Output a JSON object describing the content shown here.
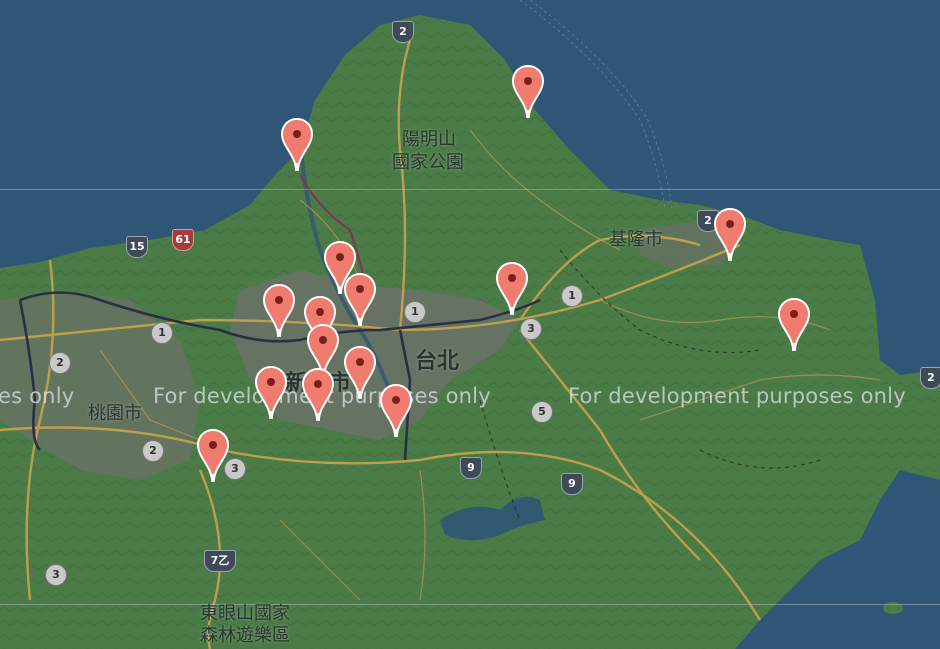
{
  "map": {
    "watermark_text": "For development purposes only",
    "watermark_left_partial": "es only",
    "watermark_mid_partial": "For develo",
    "watermark_mid_partial2": "pment purposes only",
    "colors": {
      "sea": "#2f5676",
      "land": "#4a7a45",
      "land_dark": "#3f6b3c",
      "urban": "#6a7168",
      "road_major": "#c8a24a",
      "road_minor": "#b39a55",
      "rail": "#2b2f45",
      "marker": "#f07b6f"
    }
  },
  "places": {
    "yangmingshan_line1": "陽明山",
    "yangmingshan_line2": "國家公園",
    "keelung": "基隆市",
    "taipei": "台北",
    "new_taipei": "新北市",
    "taoyuan": "桃園市",
    "dongyanshan_line1": "東眼山國家",
    "dongyanshan_line2": "森林遊樂區"
  },
  "shields": [
    "2",
    "15",
    "61",
    "1",
    "1",
    "1",
    "2",
    "2",
    "3",
    "3",
    "5",
    "9",
    "9",
    "7乙",
    "3",
    "1",
    "2"
  ],
  "markers": [
    {
      "id": "marker-1"
    },
    {
      "id": "marker-2"
    },
    {
      "id": "marker-3"
    },
    {
      "id": "marker-4"
    },
    {
      "id": "marker-5"
    },
    {
      "id": "marker-6"
    },
    {
      "id": "marker-7"
    },
    {
      "id": "marker-8"
    },
    {
      "id": "marker-9"
    },
    {
      "id": "marker-10"
    },
    {
      "id": "marker-11"
    },
    {
      "id": "marker-12"
    },
    {
      "id": "marker-13"
    },
    {
      "id": "marker-14"
    },
    {
      "id": "marker-15"
    },
    {
      "id": "marker-16"
    },
    {
      "id": "marker-17"
    }
  ]
}
